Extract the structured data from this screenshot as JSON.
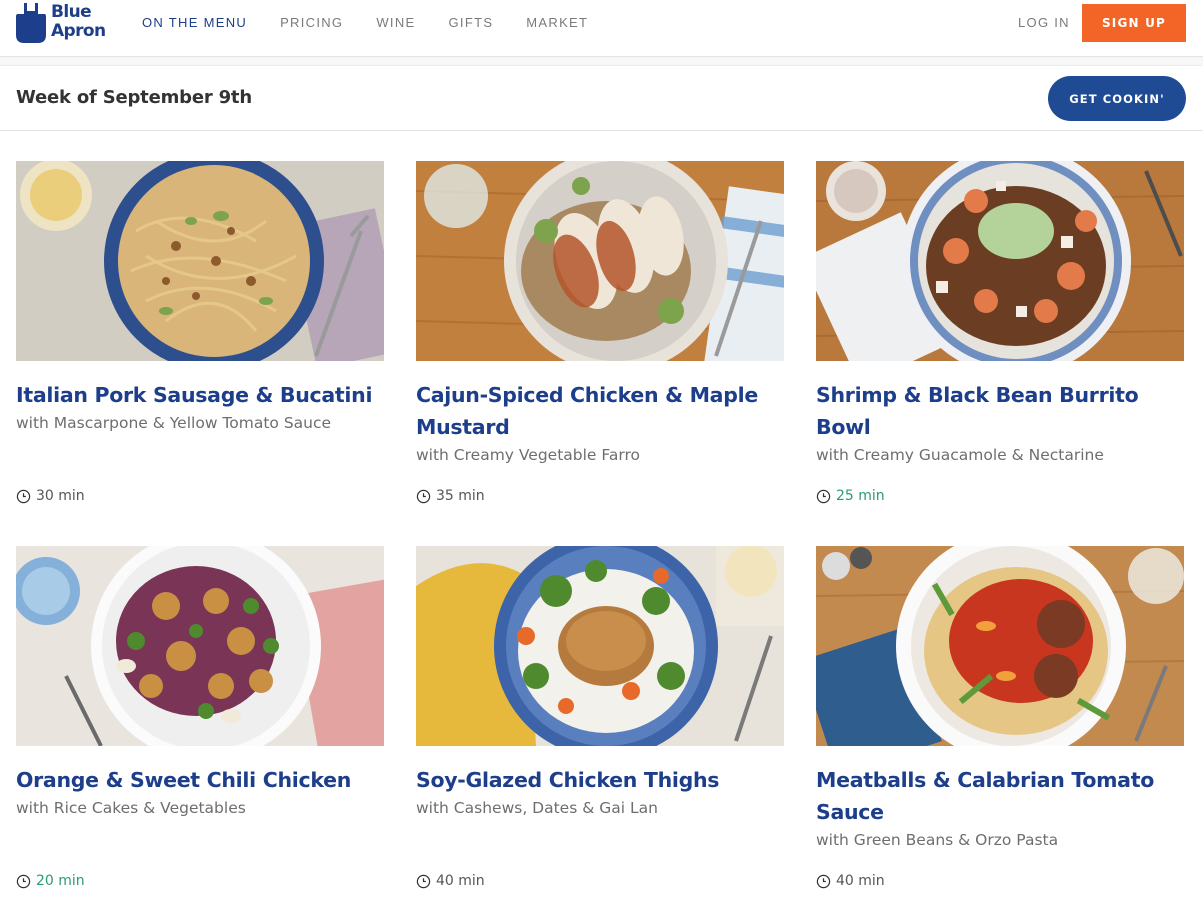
{
  "brand": {
    "line1": "Blue",
    "line2": "Apron"
  },
  "nav": {
    "items": [
      {
        "label": "ON THE MENU",
        "active": true
      },
      {
        "label": "PRICING",
        "active": false
      },
      {
        "label": "WINE",
        "active": false
      },
      {
        "label": "GIFTS",
        "active": false
      },
      {
        "label": "MARKET",
        "active": false
      }
    ],
    "login": "LOG IN",
    "signup": "SIGN UP"
  },
  "week": {
    "title": "Week of September 9th",
    "cta": "GET COOKIN'"
  },
  "colors": {
    "brand_blue": "#1d3e8a",
    "cta_blue": "#1f4b94",
    "signup_orange": "#f26527",
    "fast_time_green": "#2b9a7a"
  },
  "recipes": [
    {
      "title": "Italian Pork Sausage & Bucatini",
      "subtitle": "with Mascarpone & Yellow Tomato Sauce",
      "time": "30 min",
      "fast": false
    },
    {
      "title": "Cajun-Spiced Chicken & Maple Mustard",
      "subtitle": "with Creamy Vegetable Farro",
      "time": "35 min",
      "fast": false
    },
    {
      "title": "Shrimp & Black Bean Burrito Bowl",
      "subtitle": "with Creamy Guacamole & Nectarine",
      "time": "25 min",
      "fast": true
    },
    {
      "title": "Orange & Sweet Chili Chicken",
      "subtitle": "with Rice Cakes & Vegetables",
      "time": "20 min",
      "fast": true
    },
    {
      "title": "Soy-Glazed Chicken Thighs",
      "subtitle": "with Cashews, Dates & Gai Lan",
      "time": "40 min",
      "fast": false
    },
    {
      "title": "Meatballs & Calabrian Tomato Sauce",
      "subtitle": "with Green Beans & Orzo Pasta",
      "time": "40 min",
      "fast": false
    }
  ]
}
